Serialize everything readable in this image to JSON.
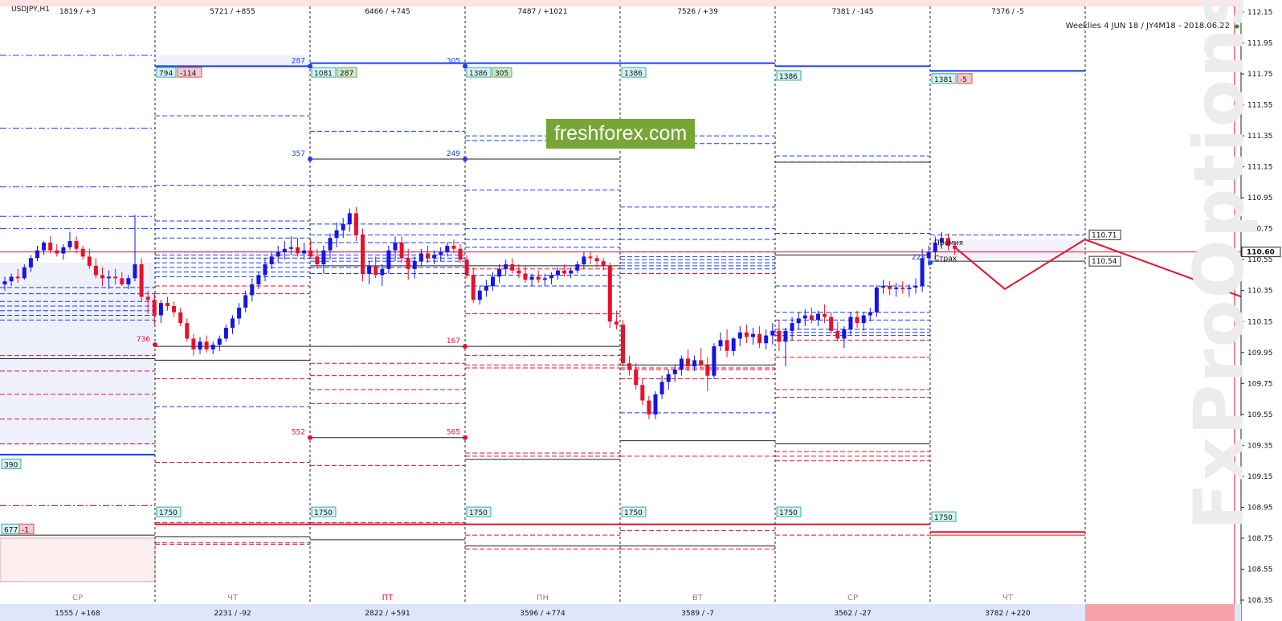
{
  "chart_data": {
    "type": "candlestick",
    "symbol": "USDJPY,H1",
    "subtitle": "Weeklies 4 JUN 18 / JY4M18 - 2018.06.22",
    "watermark": "FxProOptions",
    "brand": "freshforex.com",
    "y_axis": {
      "range": [
        108.35,
        112.15
      ],
      "ticks": [
        "112.15",
        "111.95",
        "111.75",
        "111.55",
        "111.35",
        "111.15",
        "110.95",
        "110.75",
        "110.55",
        "110.35",
        "110.15",
        "109.95",
        "109.75",
        "109.55",
        "109.35",
        "109.15",
        "108.95",
        "108.75",
        "108.55",
        "108.35"
      ],
      "current_price": "110.60",
      "marker_high": "110.71",
      "marker_low": "110.54"
    },
    "days": [
      {
        "label": "СР",
        "top": "1819 / +3",
        "bottom": "1555 / +168",
        "weekend": false
      },
      {
        "label": "ЧТ",
        "top": "5721 / +855",
        "bottom": "2231 / -92",
        "weekend": false
      },
      {
        "label": "ПТ",
        "top": "6466 / +745",
        "bottom": "2822 / +591",
        "weekend": true
      },
      {
        "label": "ПН",
        "top": "7487 / +1021",
        "bottom": "3596 / +774",
        "weekend": false
      },
      {
        "label": "ВТ",
        "top": "7526 / +39",
        "bottom": "3589 / -7",
        "weekend": false
      },
      {
        "label": "СР",
        "top": "7381 / -145",
        "bottom": "3562 / -27",
        "weekend": false
      },
      {
        "label": "ЧТ",
        "top": "7376 / -5",
        "bottom": "3782 / +220",
        "weekend": false
      }
    ],
    "candles": [
      [
        110.39,
        110.44,
        110.35,
        110.41
      ],
      [
        110.41,
        110.46,
        110.38,
        110.44
      ],
      [
        110.44,
        110.49,
        110.4,
        110.43
      ],
      [
        110.43,
        110.52,
        110.42,
        110.5
      ],
      [
        110.5,
        110.58,
        110.47,
        110.56
      ],
      [
        110.56,
        110.64,
        110.54,
        110.61
      ],
      [
        110.61,
        110.67,
        110.58,
        110.66
      ],
      [
        110.66,
        110.7,
        110.59,
        110.61
      ],
      [
        110.61,
        110.65,
        110.57,
        110.59
      ],
      [
        110.59,
        110.65,
        110.55,
        110.63
      ],
      [
        110.63,
        110.73,
        110.61,
        110.67
      ],
      [
        110.67,
        110.7,
        110.59,
        110.62
      ],
      [
        110.62,
        110.64,
        110.55,
        110.57
      ],
      [
        110.57,
        110.62,
        110.49,
        110.51
      ],
      [
        110.51,
        110.56,
        110.43,
        110.45
      ],
      [
        110.45,
        110.5,
        110.38,
        110.43
      ],
      [
        110.43,
        110.48,
        110.36,
        110.44
      ],
      [
        110.44,
        110.49,
        110.39,
        110.43
      ],
      [
        110.43,
        110.47,
        110.38,
        110.39
      ],
      [
        110.39,
        110.45,
        110.36,
        110.43
      ],
      [
        110.43,
        110.84,
        110.41,
        110.52
      ],
      [
        110.52,
        110.56,
        110.28,
        110.31
      ],
      [
        110.31,
        110.35,
        110.2,
        110.29
      ],
      [
        110.29,
        110.33,
        110.13,
        110.19
      ],
      [
        110.19,
        110.29,
        110.14,
        110.27
      ],
      [
        110.27,
        110.31,
        110.22,
        110.25
      ],
      [
        110.25,
        110.28,
        110.18,
        110.21
      ],
      [
        110.21,
        110.24,
        110.12,
        110.14
      ],
      [
        110.14,
        110.17,
        110.02,
        110.04
      ],
      [
        110.04,
        110.07,
        109.93,
        109.97
      ],
      [
        109.97,
        110.05,
        109.94,
        110.02
      ],
      [
        110.02,
        110.06,
        109.95,
        109.97
      ],
      [
        109.97,
        110.02,
        109.94,
        110.0
      ],
      [
        110.0,
        110.06,
        109.96,
        110.04
      ],
      [
        110.04,
        110.13,
        110.02,
        110.11
      ],
      [
        110.11,
        110.19,
        110.07,
        110.17
      ],
      [
        110.17,
        110.27,
        110.13,
        110.24
      ],
      [
        110.24,
        110.35,
        110.21,
        110.32
      ],
      [
        110.32,
        110.43,
        110.28,
        110.39
      ],
      [
        110.39,
        110.47,
        110.36,
        110.45
      ],
      [
        110.45,
        110.56,
        110.41,
        110.52
      ],
      [
        110.52,
        110.6,
        110.49,
        110.57
      ],
      [
        110.57,
        110.64,
        110.53,
        110.6
      ],
      [
        110.6,
        110.67,
        110.55,
        110.62
      ],
      [
        110.62,
        110.7,
        110.58,
        110.63
      ],
      [
        110.63,
        110.69,
        110.57,
        110.59
      ],
      [
        110.59,
        110.66,
        110.55,
        110.61
      ],
      [
        110.61,
        110.68,
        110.56,
        110.57
      ],
      [
        110.57,
        110.62,
        110.49,
        110.52
      ],
      [
        110.52,
        110.64,
        110.46,
        110.61
      ],
      [
        110.61,
        110.72,
        110.55,
        110.69
      ],
      [
        110.69,
        110.79,
        110.63,
        110.74
      ],
      [
        110.74,
        110.82,
        110.69,
        110.78
      ],
      [
        110.78,
        110.88,
        110.73,
        110.85
      ],
      [
        110.85,
        110.89,
        110.67,
        110.71
      ],
      [
        110.71,
        110.75,
        110.41,
        110.46
      ],
      [
        110.46,
        110.54,
        110.39,
        110.51
      ],
      [
        110.51,
        110.57,
        110.43,
        110.45
      ],
      [
        110.45,
        110.52,
        110.38,
        110.49
      ],
      [
        110.49,
        110.64,
        110.46,
        110.61
      ],
      [
        110.61,
        110.7,
        110.54,
        110.66
      ],
      [
        110.66,
        110.7,
        110.53,
        110.56
      ],
      [
        110.56,
        110.62,
        110.42,
        110.49
      ],
      [
        110.49,
        110.57,
        110.43,
        110.54
      ],
      [
        110.54,
        110.62,
        110.51,
        110.59
      ],
      [
        110.59,
        110.64,
        110.53,
        110.56
      ],
      [
        110.56,
        110.61,
        110.52,
        110.58
      ],
      [
        110.58,
        110.63,
        110.54,
        110.6
      ],
      [
        110.6,
        110.66,
        110.57,
        110.64
      ],
      [
        110.64,
        110.68,
        110.59,
        110.62
      ],
      [
        110.62,
        110.65,
        110.53,
        110.55
      ],
      [
        110.55,
        110.58,
        110.43,
        110.45
      ],
      [
        110.45,
        110.5,
        110.27,
        110.29
      ],
      [
        110.29,
        110.38,
        110.26,
        110.35
      ],
      [
        110.35,
        110.42,
        110.31,
        110.38
      ],
      [
        110.38,
        110.47,
        110.35,
        110.44
      ],
      [
        110.44,
        110.52,
        110.4,
        110.49
      ],
      [
        110.49,
        110.55,
        110.45,
        110.52
      ],
      [
        110.52,
        110.56,
        110.46,
        110.48
      ],
      [
        110.48,
        110.52,
        110.43,
        110.46
      ],
      [
        110.46,
        110.51,
        110.4,
        110.42
      ],
      [
        110.42,
        110.46,
        110.38,
        110.44
      ],
      [
        110.44,
        110.48,
        110.4,
        110.42
      ],
      [
        110.42,
        110.46,
        110.38,
        110.43
      ],
      [
        110.43,
        110.47,
        110.39,
        110.45
      ],
      [
        110.45,
        110.5,
        110.42,
        110.48
      ],
      [
        110.48,
        110.52,
        110.44,
        110.46
      ],
      [
        110.46,
        110.5,
        110.43,
        110.48
      ],
      [
        110.48,
        110.54,
        110.46,
        110.52
      ],
      [
        110.52,
        110.6,
        110.49,
        110.57
      ],
      [
        110.57,
        110.6,
        110.52,
        110.56
      ],
      [
        110.56,
        110.58,
        110.5,
        110.54
      ],
      [
        110.54,
        110.56,
        110.48,
        110.51
      ],
      [
        110.51,
        110.53,
        110.11,
        110.15
      ],
      [
        110.15,
        110.22,
        110.1,
        110.13
      ],
      [
        110.13,
        110.16,
        109.86,
        109.88
      ],
      [
        109.88,
        109.93,
        109.8,
        109.84
      ],
      [
        109.84,
        109.88,
        109.71,
        109.74
      ],
      [
        109.74,
        109.78,
        109.61,
        109.64
      ],
      [
        109.64,
        109.67,
        109.52,
        109.55
      ],
      [
        109.55,
        109.7,
        109.52,
        109.68
      ],
      [
        109.68,
        109.8,
        109.65,
        109.76
      ],
      [
        109.76,
        109.84,
        109.71,
        109.81
      ],
      [
        109.81,
        109.87,
        109.76,
        109.84
      ],
      [
        109.84,
        109.93,
        109.8,
        109.91
      ],
      [
        109.91,
        109.97,
        109.83,
        109.86
      ],
      [
        109.86,
        109.93,
        109.83,
        109.9
      ],
      [
        109.9,
        109.98,
        109.85,
        109.87
      ],
      [
        109.87,
        109.92,
        109.7,
        109.8
      ],
      [
        109.8,
        110.01,
        109.78,
        109.99
      ],
      [
        109.99,
        110.08,
        109.96,
        110.03
      ],
      [
        110.03,
        110.1,
        109.92,
        109.96
      ],
      [
        109.96,
        110.05,
        109.93,
        110.04
      ],
      [
        110.04,
        110.12,
        109.99,
        110.08
      ],
      [
        110.08,
        110.13,
        110.01,
        110.05
      ],
      [
        110.05,
        110.11,
        110.0,
        110.07
      ],
      [
        110.07,
        110.12,
        109.98,
        110.01
      ],
      [
        110.01,
        110.1,
        109.97,
        110.06
      ],
      [
        110.06,
        110.14,
        110.0,
        110.09
      ],
      [
        110.09,
        110.16,
        109.96,
        110.02
      ],
      [
        110.02,
        110.11,
        109.86,
        110.09
      ],
      [
        110.09,
        110.18,
        110.03,
        110.14
      ],
      [
        110.14,
        110.21,
        110.1,
        110.17
      ],
      [
        110.17,
        110.23,
        110.12,
        110.19
      ],
      [
        110.19,
        110.24,
        110.14,
        110.16
      ],
      [
        110.16,
        110.22,
        110.12,
        110.2
      ],
      [
        110.2,
        110.26,
        110.14,
        110.18
      ],
      [
        110.18,
        110.21,
        110.07,
        110.09
      ],
      [
        110.09,
        110.15,
        110.02,
        110.04
      ],
      [
        110.04,
        110.12,
        109.98,
        110.1
      ],
      [
        110.1,
        110.21,
        110.06,
        110.18
      ],
      [
        110.18,
        110.22,
        110.11,
        110.14
      ],
      [
        110.14,
        110.21,
        110.09,
        110.19
      ],
      [
        110.19,
        110.24,
        110.15,
        110.21
      ],
      [
        110.21,
        110.38,
        110.18,
        110.37
      ],
      [
        110.37,
        110.42,
        110.33,
        110.38
      ],
      [
        110.38,
        110.41,
        110.32,
        110.36
      ],
      [
        110.36,
        110.4,
        110.31,
        110.37
      ],
      [
        110.37,
        110.41,
        110.33,
        110.36
      ],
      [
        110.36,
        110.39,
        110.31,
        110.37
      ],
      [
        110.37,
        110.43,
        110.33,
        110.38
      ],
      [
        110.38,
        110.62,
        110.34,
        110.56
      ],
      [
        110.56,
        110.64,
        110.51,
        110.6
      ],
      [
        110.6,
        110.7,
        110.55,
        110.66
      ],
      [
        110.66,
        110.73,
        110.62,
        110.69
      ],
      [
        110.69,
        110.72,
        110.61,
        110.64
      ],
      [
        110.64,
        110.67,
        110.58,
        110.62
      ]
    ],
    "forecast_path": [
      {
        "price": 110.63,
        "offset": 0
      },
      {
        "price": 110.36,
        "offset": 10
      },
      {
        "price": 110.68,
        "offset": 26
      },
      {
        "price": 109.97,
        "offset": 86
      }
    ],
    "labels": {
      "blue_top": [
        "794",
        "1081",
        "1386",
        "1386",
        "1386",
        "1381"
      ],
      "blue_top_change": [
        "-114",
        "287",
        "305",
        "-5"
      ],
      "blue_bottom": "390",
      "red_bottom": [
        "1750",
        "1750",
        "1750",
        "1750",
        "1750",
        "1750"
      ],
      "left_bottom": [
        "677",
        "-1"
      ],
      "strike_points": [
        {
          "value": "287",
          "price": 111.8
        },
        {
          "value": "305",
          "price": 111.8
        },
        {
          "value": "357",
          "price": 111.2
        },
        {
          "value": "249",
          "price": 111.2
        },
        {
          "value": "736",
          "price": 110.0
        },
        {
          "value": "167",
          "price": 109.99
        },
        {
          "value": "552",
          "price": 109.4
        },
        {
          "value": "565",
          "price": 109.4
        },
        {
          "value": "223",
          "price": 110.53
        }
      ],
      "premium": "Премия",
      "insurance": "Страх"
    },
    "colors": {
      "bull": "#1515e6",
      "bear": "#e8102a",
      "blue_line": "#1a3cff",
      "red_line": "#e8102a",
      "grid": "#000000"
    }
  }
}
